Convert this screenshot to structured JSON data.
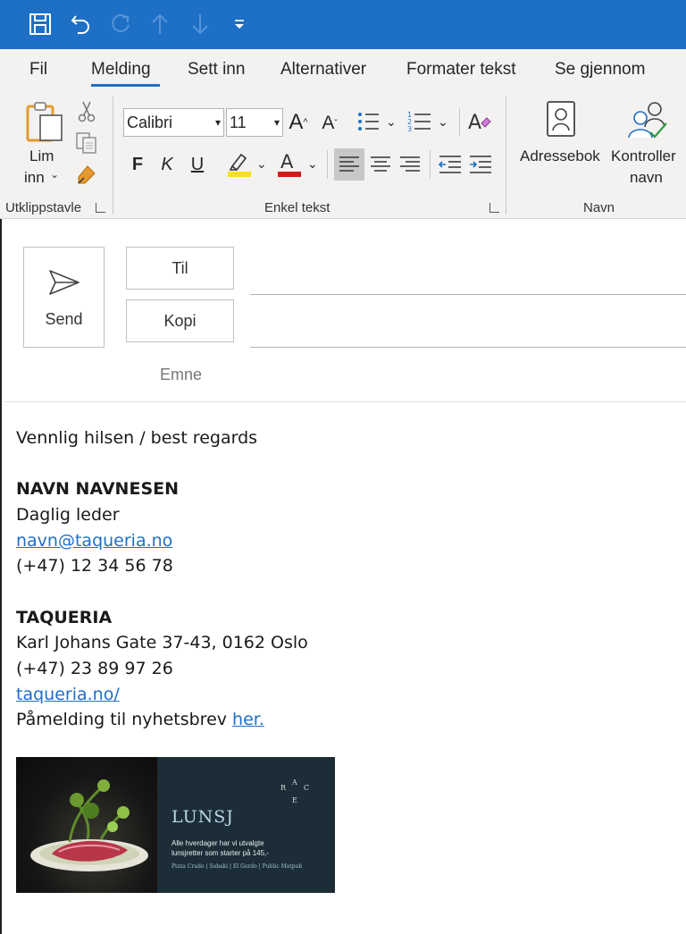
{
  "ribbon_tabs": [
    "Fil",
    "Melding",
    "Sett inn",
    "Alternativer",
    "Formater tekst",
    "Se gjennom"
  ],
  "active_tab": "Melding",
  "clipboard": {
    "paste_label_1": "Lim",
    "paste_label_2": "inn",
    "group_label": "Utklippstavle"
  },
  "font": {
    "name": "Calibri",
    "size": "11"
  },
  "format": {
    "bold": "F",
    "italic": "K",
    "underline": "U",
    "group_label": "Enkel tekst",
    "grow": "A",
    "shrink": "A",
    "highlight_color": "#f5e01c",
    "font_color": "#d11b1b"
  },
  "names": {
    "address_book": "Adressebok",
    "check_1": "Kontroller",
    "check_2": "navn",
    "group_label": "Navn"
  },
  "compose": {
    "send_label": "Send",
    "to_label": "Til",
    "cc_label": "Kopi",
    "subject_label": "Emne"
  },
  "signature": {
    "greeting": "Vennlig hilsen / best regards",
    "name": "NAVN NAVNESEN",
    "title": "Daglig leder",
    "email": "navn@taqueria.no",
    "phone": "(+47) 12 34 56 78",
    "company": "TAQUERIA",
    "address": "Karl Johans Gate 37-43, 0162 Oslo",
    "company_phone": "(+47) 23 89 97 26",
    "website": "taqueria.no/",
    "newsletter_text": "Påmelding til nyhetsbrev ",
    "newsletter_link": "her."
  },
  "banner": {
    "heading": "LUNSJ",
    "line1": "Alle hverdager har vi utvalgte",
    "line2": "lunsjretter som starter på 145,-",
    "footer": "Pizza Crudo | Sabaki | El Gordo | Public Matpub",
    "logo": "RACE"
  },
  "colors": {
    "accent": "#1e6fc6",
    "ribbon_bg": "#f3f2f1",
    "banner_bg": "#1d2d38"
  }
}
